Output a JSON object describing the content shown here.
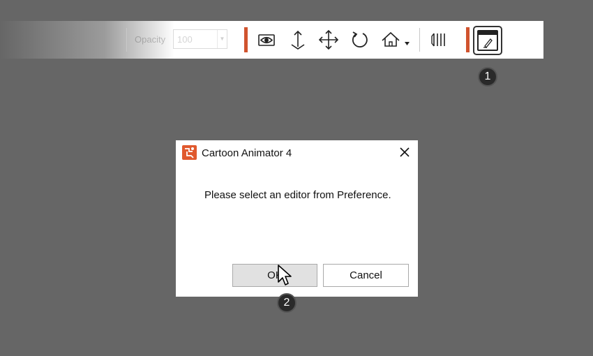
{
  "toolbar": {
    "opacity_label": "Opacity",
    "opacity_value": "100",
    "tools": [
      "camera-view-icon",
      "move-vertical-icon",
      "move-icon",
      "rotate-icon",
      "home-icon",
      "align-icon",
      "open-editor-icon"
    ],
    "accent_color": "#d0532e"
  },
  "steps": {
    "one": "1",
    "two": "2"
  },
  "dialog": {
    "title": "Cartoon Animator 4",
    "message": "Please select an editor from Preference.",
    "ok_label": "OK",
    "cancel_label": "Cancel"
  }
}
